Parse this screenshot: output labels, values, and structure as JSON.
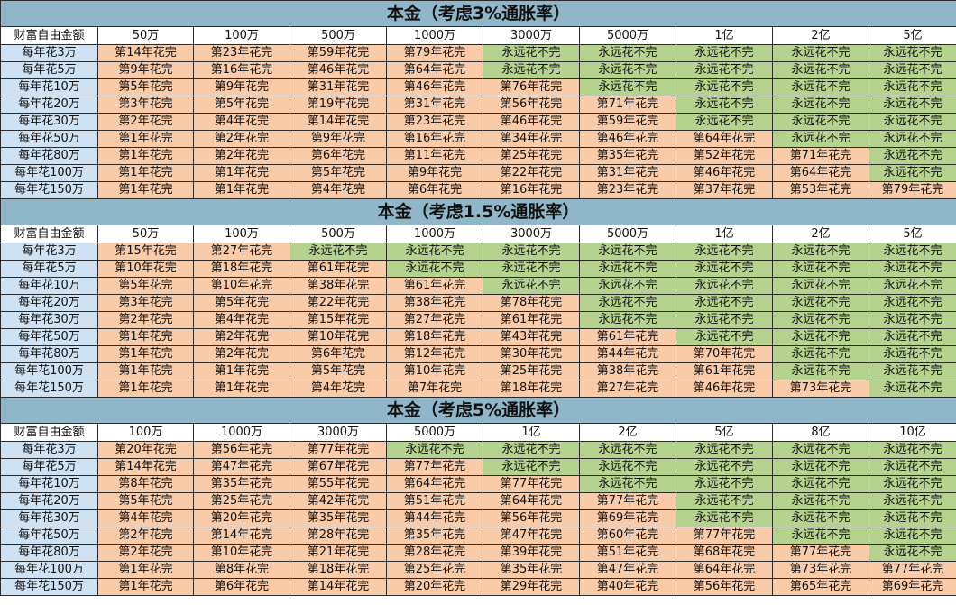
{
  "colors": {
    "title_bg": "#8fb7c9",
    "row_label_bg": "#cfe2f3",
    "finite_bg": "#f9cba8",
    "forever_bg": "#b5d28f"
  },
  "tables": [
    {
      "title": "本金（考虑3%通胀率）",
      "corner": "财富自由金额",
      "columns": [
        "50万",
        "100万",
        "500万",
        "1000万",
        "3000万",
        "5000万",
        "1亿",
        "2亿",
        "5亿"
      ],
      "rows": [
        {
          "label": "每年花3万",
          "cells": [
            "第14年花完",
            "第23年花完",
            "第59年花完",
            "第79年花完",
            "永远花不完",
            "永远花不完",
            "永远花不完",
            "永远花不完",
            "永远花不完"
          ]
        },
        {
          "label": "每年花5万",
          "cells": [
            "第9年花完",
            "第16年花完",
            "第46年花完",
            "第64年花完",
            "永远花不完",
            "永远花不完",
            "永远花不完",
            "永远花不完",
            "永远花不完"
          ]
        },
        {
          "label": "每年花10万",
          "cells": [
            "第5年花完",
            "第9年花完",
            "第31年花完",
            "第46年花完",
            "第76年花完",
            "永远花不完",
            "永远花不完",
            "永远花不完",
            "永远花不完"
          ]
        },
        {
          "label": "每年花20万",
          "cells": [
            "第3年花完",
            "第5年花完",
            "第19年花完",
            "第31年花完",
            "第56年花完",
            "第71年花完",
            "永远花不完",
            "永远花不完",
            "永远花不完"
          ]
        },
        {
          "label": "每年花30万",
          "cells": [
            "第2年花完",
            "第4年花完",
            "第14年花完",
            "第23年花完",
            "第46年花完",
            "第59年花完",
            "永远花不完",
            "永远花不完",
            "永远花不完"
          ]
        },
        {
          "label": "每年花50万",
          "cells": [
            "第1年花完",
            "第2年花完",
            "第9年花完",
            "第16年花完",
            "第34年花完",
            "第46年花完",
            "第64年花完",
            "永远花不完",
            "永远花不完"
          ]
        },
        {
          "label": "每年花80万",
          "cells": [
            "第1年花完",
            "第2年花完",
            "第6年花完",
            "第11年花完",
            "第25年花完",
            "第35年花完",
            "第52年花完",
            "第71年花完",
            "永远花不完"
          ]
        },
        {
          "label": "每年花100万",
          "cells": [
            "第1年花完",
            "第1年花完",
            "第5年花完",
            "第9年花完",
            "第22年花完",
            "第31年花完",
            "第46年花完",
            "第64年花完",
            "永远花不完"
          ]
        },
        {
          "label": "每年花150万",
          "cells": [
            "第1年花完",
            "第1年花完",
            "第4年花完",
            "第6年花完",
            "第16年花完",
            "第23年花完",
            "第37年花完",
            "第53年花完",
            "第79年花完"
          ]
        }
      ]
    },
    {
      "title": "本金（考虑1.5%通胀率）",
      "corner": "财富自由金额",
      "columns": [
        "50万",
        "100万",
        "500万",
        "1000万",
        "3000万",
        "5000万",
        "1亿",
        "2亿",
        "5亿"
      ],
      "rows": [
        {
          "label": "每年花3万",
          "cells": [
            "第15年花完",
            "第27年花完",
            "永远花不完",
            "永远花不完",
            "永远花不完",
            "永远花不完",
            "永远花不完",
            "永远花不完",
            "永远花不完"
          ]
        },
        {
          "label": "每年花5万",
          "cells": [
            "第10年花完",
            "第18年花完",
            "第61年花完",
            "永远花不完",
            "永远花不完",
            "永远花不完",
            "永远花不完",
            "永远花不完",
            "永远花不完"
          ]
        },
        {
          "label": "每年花10万",
          "cells": [
            "第5年花完",
            "第10年花完",
            "第38年花完",
            "第61年花完",
            "永远花不完",
            "永远花不完",
            "永远花不完",
            "永远花不完",
            "永远花不完"
          ]
        },
        {
          "label": "每年花20万",
          "cells": [
            "第3年花完",
            "第5年花完",
            "第22年花完",
            "第38年花完",
            "第78年花完",
            "永远花不完",
            "永远花不完",
            "永远花不完",
            "永远花不完"
          ]
        },
        {
          "label": "每年花30万",
          "cells": [
            "第2年花完",
            "第4年花完",
            "第15年花完",
            "第27年花完",
            "第61年花完",
            "永远花不完",
            "永远花不完",
            "永远花不完",
            "永远花不完"
          ]
        },
        {
          "label": "每年花50万",
          "cells": [
            "第1年花完",
            "第2年花完",
            "第10年花完",
            "第18年花完",
            "第43年花完",
            "第61年花完",
            "永远花不完",
            "永远花不完",
            "永远花不完"
          ]
        },
        {
          "label": "每年花80万",
          "cells": [
            "第1年花完",
            "第2年花完",
            "第6年花完",
            "第12年花完",
            "第30年花完",
            "第44年花完",
            "第70年花完",
            "永远花不完",
            "永远花不完"
          ]
        },
        {
          "label": "每年花100万",
          "cells": [
            "第1年花完",
            "第1年花完",
            "第5年花完",
            "第10年花完",
            "第25年花完",
            "第38年花完",
            "第61年花完",
            "永远花不完",
            "永远花不完"
          ]
        },
        {
          "label": "每年花150万",
          "cells": [
            "第1年花完",
            "第1年花完",
            "第4年花完",
            "第7年花完",
            "第18年花完",
            "第27年花完",
            "第46年花完",
            "第73年花完",
            "永远花不完"
          ]
        }
      ]
    },
    {
      "title": "本金（考虑5%通胀率）",
      "corner": "财富自由金额",
      "columns": [
        "100万",
        "1000万",
        "3000万",
        "5000万",
        "1亿",
        "2亿",
        "5亿",
        "8亿",
        "10亿"
      ],
      "rows": [
        {
          "label": "每年花3万",
          "cells": [
            "第20年花完",
            "第56年花完",
            "第77年花完",
            "永远花不完",
            "永远花不完",
            "永远花不完",
            "永远花不完",
            "永远花不完",
            "永远花不完"
          ]
        },
        {
          "label": "每年花5万",
          "cells": [
            "第14年花完",
            "第47年花完",
            "第67年花完",
            "第77年花完",
            "永远花不完",
            "永远花不完",
            "永远花不完",
            "永远花不完",
            "永远花不完"
          ]
        },
        {
          "label": "每年花10万",
          "cells": [
            "第8年花完",
            "第35年花完",
            "第55年花完",
            "第64年花完",
            "第77年花完",
            "永远花不完",
            "永远花不完",
            "永远花不完",
            "永远花不完"
          ]
        },
        {
          "label": "每年花20万",
          "cells": [
            "第5年花完",
            "第25年花完",
            "第42年花完",
            "第51年花完",
            "第64年花完",
            "第77年花完",
            "永远花不完",
            "永远花不完",
            "永远花不完"
          ]
        },
        {
          "label": "每年花30万",
          "cells": [
            "第4年花完",
            "第20年花完",
            "第35年花完",
            "第44年花完",
            "第56年花完",
            "第69年花完",
            "永远花不完",
            "永远花不完",
            "永远花不完"
          ]
        },
        {
          "label": "每年花50万",
          "cells": [
            "第2年花完",
            "第14年花完",
            "第28年花完",
            "第35年花完",
            "第47年花完",
            "第60年花完",
            "第77年花完",
            "永远花不完",
            "永远花不完"
          ]
        },
        {
          "label": "每年花80万",
          "cells": [
            "第2年花完",
            "第10年花完",
            "第21年花完",
            "第28年花完",
            "第39年花完",
            "第51年花完",
            "第68年花完",
            "第77年花完",
            "永远花不完"
          ]
        },
        {
          "label": "每年花100万",
          "cells": [
            "第1年花完",
            "第8年花完",
            "第18年花完",
            "第25年花完",
            "第35年花完",
            "第47年花完",
            "第64年花完",
            "第73年花完",
            "第77年花完"
          ]
        },
        {
          "label": "每年花150万",
          "cells": [
            "第1年花完",
            "第6年花完",
            "第14年花完",
            "第20年花完",
            "第29年花完",
            "第40年花完",
            "第56年花完",
            "第65年花完",
            "第69年花完"
          ]
        }
      ]
    }
  ]
}
